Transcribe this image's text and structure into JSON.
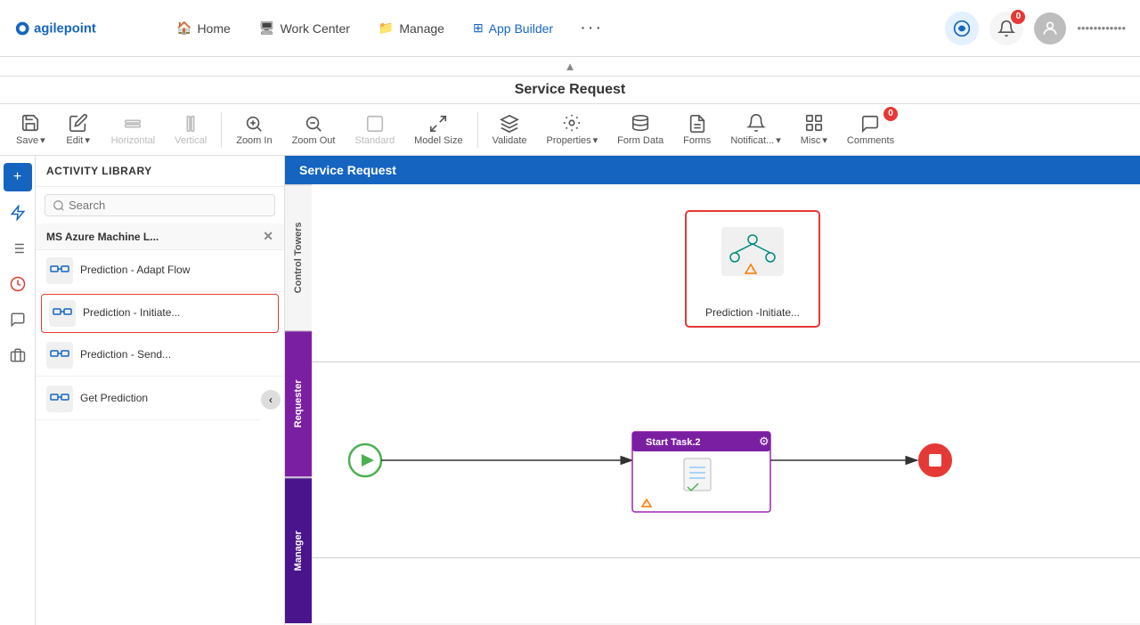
{
  "app": {
    "logo_text": "agilepoint"
  },
  "nav": {
    "items": [
      {
        "label": "Home",
        "icon": "🏠",
        "active": false
      },
      {
        "label": "Work Center",
        "icon": "🖥️",
        "active": false
      },
      {
        "label": "Manage",
        "icon": "📁",
        "active": false
      },
      {
        "label": "App Builder",
        "icon": "⊞",
        "active": true
      }
    ],
    "more_icon": "···",
    "ai_icon": "✳",
    "notifications_count": "0",
    "username": "••••••••••••"
  },
  "page": {
    "title": "Service Request",
    "collapse_icon": "▲"
  },
  "toolbar": {
    "save_label": "Save",
    "edit_label": "Edit",
    "horizontal_label": "Horizontal",
    "vertical_label": "Vertical",
    "zoom_in_label": "Zoom In",
    "zoom_out_label": "Zoom Out",
    "standard_label": "Standard",
    "model_size_label": "Model Size",
    "validate_label": "Validate",
    "properties_label": "Properties",
    "form_data_label": "Form Data",
    "forms_label": "Forms",
    "notifications_label": "Notificat...",
    "misc_label": "Misc",
    "comments_label": "Comments",
    "comments_count": "0"
  },
  "activity_library": {
    "title": "ACTIVITY LIBRARY",
    "search_placeholder": "Search",
    "category": "MS Azure Machine L...",
    "items": [
      {
        "label": "Prediction - Adapt Flow",
        "selected": false
      },
      {
        "label": "Prediction - Initiate...",
        "selected": true
      },
      {
        "label": "Prediction - Send...",
        "selected": false
      },
      {
        "label": "Get Prediction",
        "selected": false
      }
    ]
  },
  "canvas": {
    "title": "Service Request",
    "lanes": [
      {
        "label": "Control Towers"
      },
      {
        "label": "Requester"
      },
      {
        "label": "Manager"
      }
    ],
    "nodes": [
      {
        "id": "prediction",
        "label": "Prediction -Initiate...",
        "type": "ml",
        "selected": true
      },
      {
        "id": "start",
        "label": "",
        "type": "start"
      },
      {
        "id": "task1",
        "label": "Start Task.2",
        "type": "task"
      },
      {
        "id": "end",
        "label": "",
        "type": "end"
      }
    ]
  }
}
